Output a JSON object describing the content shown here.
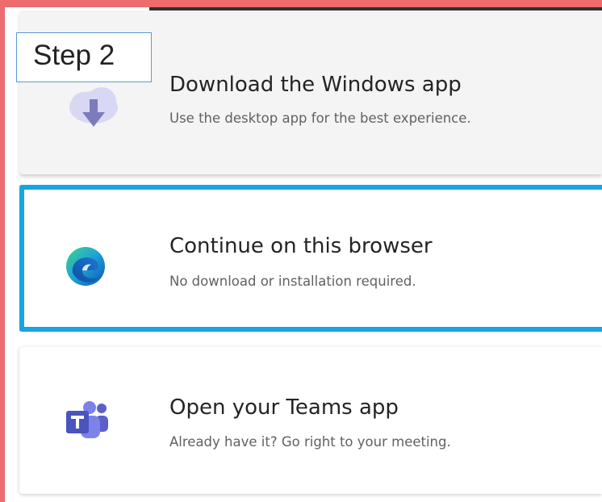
{
  "step_label": "Step 2",
  "options": {
    "download": {
      "title": "Download the Windows app",
      "subtitle": "Use the desktop app for the best experience.",
      "icon": "download-cloud-icon"
    },
    "browser": {
      "title": "Continue on this browser",
      "subtitle": "No download or installation required.",
      "icon": "edge-browser-icon"
    },
    "teams": {
      "title": "Open your Teams app",
      "subtitle": "Already have it? Go right to your meeting.",
      "icon": "teams-icon"
    }
  },
  "colors": {
    "frame_border": "#ee6b6e",
    "selected_border": "#1aa3e2",
    "teams_purple": "#5b5fc7"
  }
}
